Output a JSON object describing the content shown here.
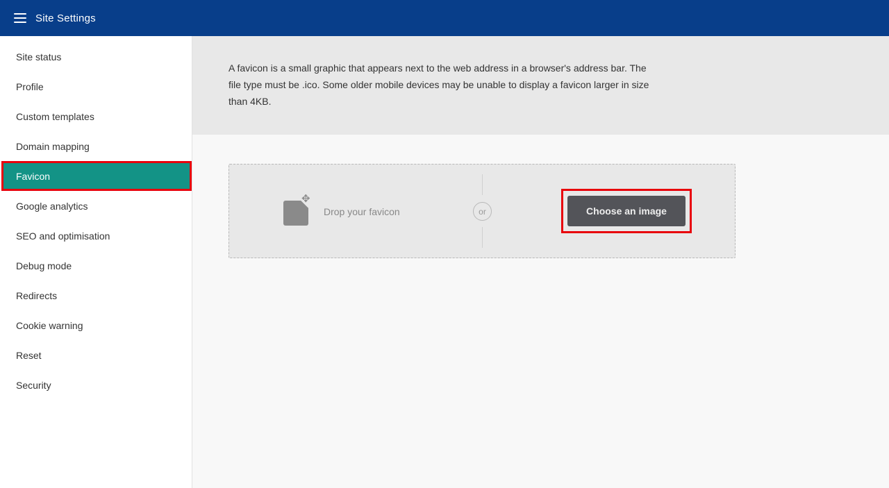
{
  "header": {
    "title": "Site Settings",
    "background": "#083e8a"
  },
  "sidebar": {
    "items": [
      {
        "label": "Site status"
      },
      {
        "label": "Profile"
      },
      {
        "label": "Custom templates"
      },
      {
        "label": "Domain mapping"
      },
      {
        "label": "Favicon",
        "active": true
      },
      {
        "label": "Google analytics"
      },
      {
        "label": "SEO and optimisation"
      },
      {
        "label": "Debug mode"
      },
      {
        "label": "Redirects"
      },
      {
        "label": "Cookie warning"
      },
      {
        "label": "Reset"
      },
      {
        "label": "Security"
      }
    ],
    "active_color": "#139386",
    "highlight_color": "#e8000b"
  },
  "main": {
    "description": "A favicon is a small graphic that appears next to the web address in a browser's address bar. The file type must be .ico. Some older mobile devices may be unable to display a favicon larger in size than 4KB.",
    "dropzone": {
      "drop_label": "Drop your favicon",
      "or_label": "or",
      "choose_button": "Choose an image",
      "icon": "file-add-icon"
    }
  }
}
